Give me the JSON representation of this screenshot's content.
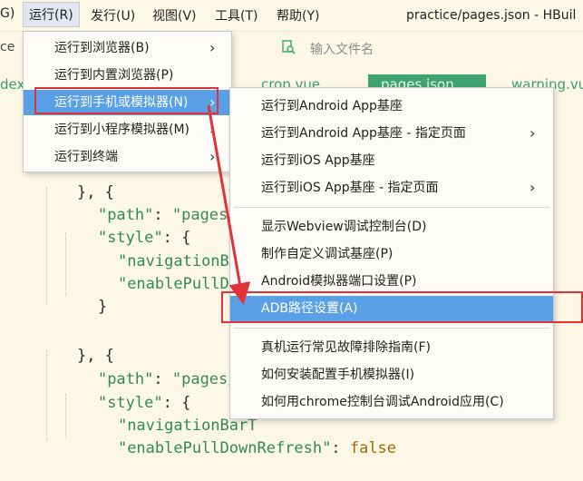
{
  "menubar": {
    "items": [
      {
        "label": "G)"
      },
      {
        "label": "运行(R)"
      },
      {
        "label": "发行(U)"
      },
      {
        "label": "视图(V)"
      },
      {
        "label": "工具(T)"
      },
      {
        "label": "帮助(Y)"
      }
    ],
    "window_title": "practice/pages.json - HBuil"
  },
  "toolbar": {
    "left_fragment": "ce",
    "file_search_placeholder": "输入文件名",
    "file_search_icon": "search-file-icon"
  },
  "tabs": [
    {
      "label": "dex"
    },
    {
      "label": "crop.vue"
    },
    {
      "label": "pages.json",
      "active": true
    },
    {
      "label": "warning.vu"
    }
  ],
  "editor": {
    "lines": [
      {
        "prefix": "}, {",
        "key": "",
        "sep": "",
        "value": ""
      },
      {
        "prefix": "",
        "key": "\"path\"",
        "sep": ": ",
        "value": "\"pages/ho"
      },
      {
        "prefix": "",
        "key": "\"style\"",
        "sep": ": {",
        "value": ""
      },
      {
        "prefix": "",
        "key": "\"navigationBarT",
        "sep": "",
        "value": ""
      },
      {
        "prefix": "",
        "key": "\"enablePullDown",
        "sep": "",
        "value": ""
      },
      {
        "prefix": "}",
        "key": "",
        "sep": "",
        "value": ""
      },
      {
        "prefix": "",
        "key": "",
        "sep": "",
        "value": ""
      },
      {
        "prefix": "}, {",
        "key": "",
        "sep": "",
        "value": ""
      },
      {
        "prefix": "",
        "key": "\"path\"",
        "sep": ": ",
        "value": "\"pages/wa"
      },
      {
        "prefix": "",
        "key": "\"style\"",
        "sep": ": {",
        "value": ""
      },
      {
        "prefix": "",
        "key": "\"navigationBarT",
        "sep": "",
        "value": ""
      },
      {
        "prefix": "",
        "key": "\"enablePullDownRefresh\"",
        "sep": ": ",
        "value": "false"
      }
    ]
  },
  "run_menu": {
    "items": [
      {
        "label": "运行到浏览器(B)",
        "submenu": true
      },
      {
        "label": "运行到内置浏览器(P)",
        "submenu": false
      },
      {
        "label": "运行到手机或模拟器(N)",
        "submenu": true,
        "highlighted": true
      },
      {
        "label": "运行到小程序模拟器(M)",
        "submenu": true
      },
      {
        "label": "运行到终端",
        "submenu": true
      }
    ]
  },
  "device_submenu": {
    "items": [
      {
        "label": "运行到Android App基座",
        "submenu": false
      },
      {
        "label": "运行到Android App基座 - 指定页面",
        "submenu": true
      },
      {
        "label": "运行到iOS App基座",
        "submenu": false
      },
      {
        "label": "运行到iOS App基座 - 指定页面",
        "submenu": true
      },
      {
        "label": "显示Webview调试控制台(D)",
        "submenu": false
      },
      {
        "label": "制作自定义调试基座(P)",
        "submenu": false
      },
      {
        "label": "Android模拟器端口设置(P)",
        "submenu": false
      },
      {
        "label": "ADB路径设置(A)",
        "submenu": false,
        "highlighted": true
      },
      {
        "label": "真机运行常见故障排除指南(F)",
        "submenu": false
      },
      {
        "label": "如何安装配置手机模拟器(I)",
        "submenu": false
      },
      {
        "label": "如何用chrome控制台调试Android应用(C)",
        "submenu": false
      }
    ]
  },
  "colors": {
    "background": "#fdf8e6",
    "menu_highlight": "#5aa0e6",
    "annotation_red": "#e3313a",
    "tab_active": "#3ea36f",
    "json_key": "#2e8b57",
    "json_value": "#a0690d"
  }
}
